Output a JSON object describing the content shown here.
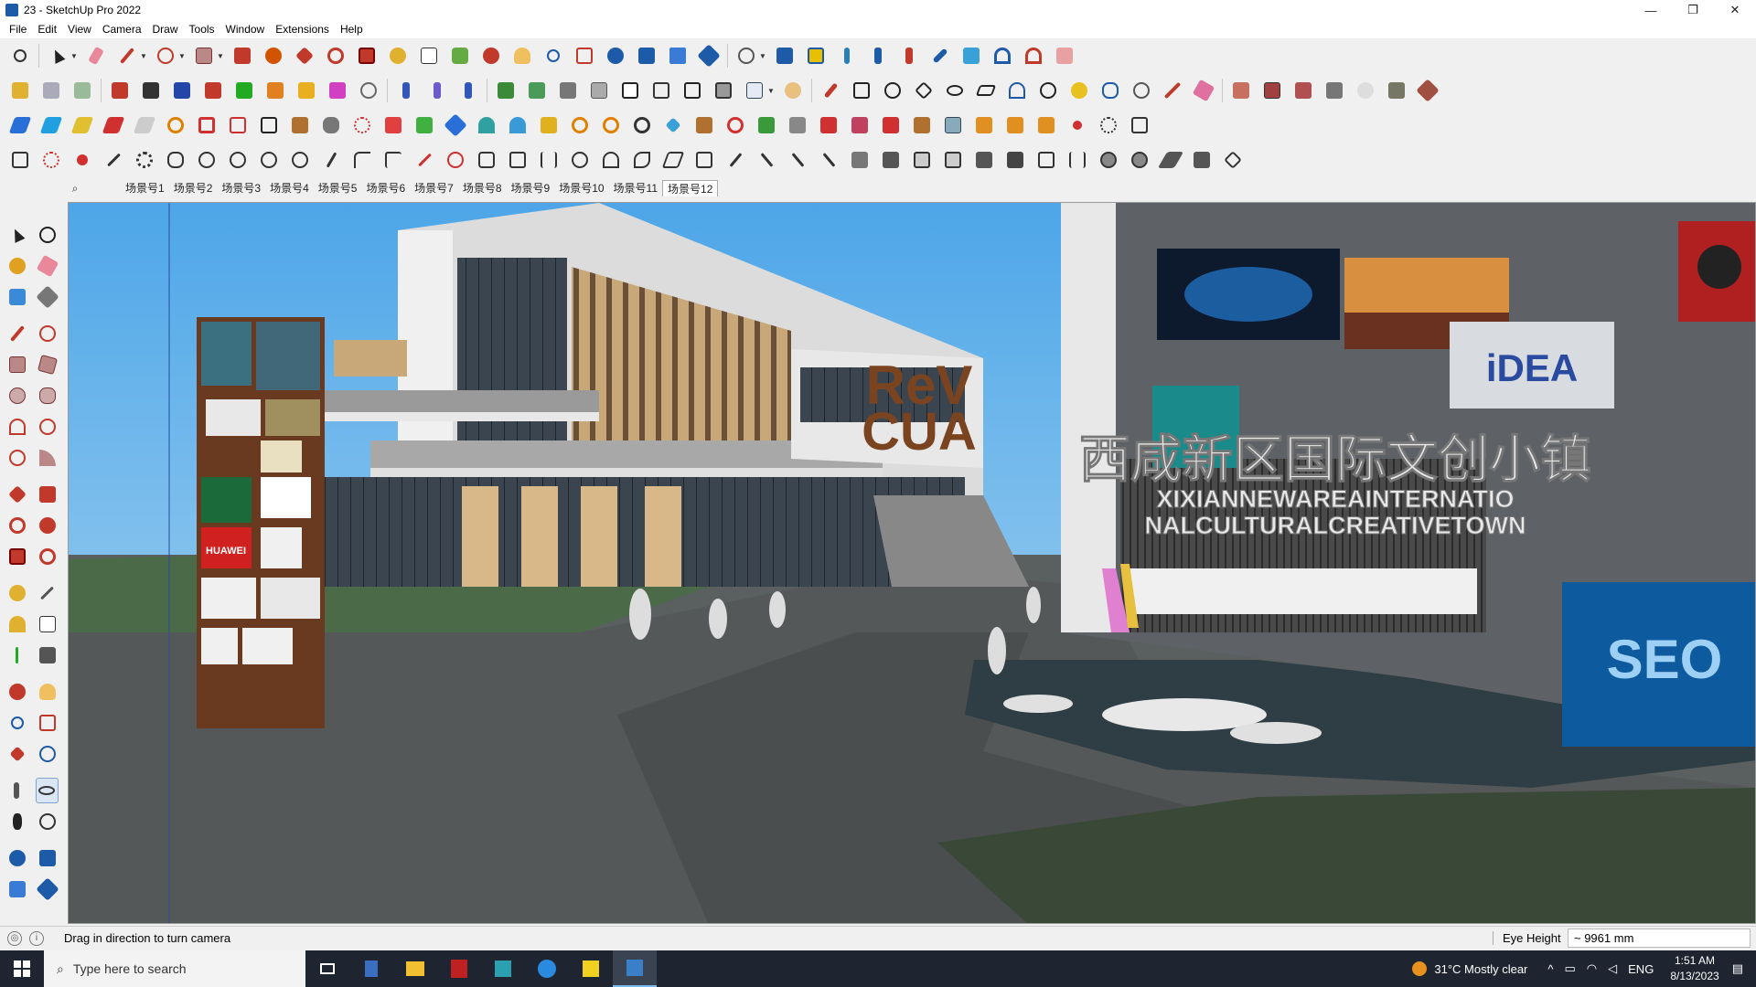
{
  "window": {
    "title": "23 - SketchUp Pro 2022",
    "controls": [
      "—",
      "❐",
      "✕"
    ]
  },
  "menu": [
    "File",
    "Edit",
    "View",
    "Camera",
    "Draw",
    "Tools",
    "Window",
    "Extensions",
    "Help"
  ],
  "scenes": {
    "tabs": [
      "场景号1",
      "场景号2",
      "场景号3",
      "场景号4",
      "场景号5",
      "场景号6",
      "场景号7",
      "场景号8",
      "场景号9",
      "场景号10",
      "场景号11",
      "场景号12"
    ],
    "active_index": 11
  },
  "viewport": {
    "sign_cn": "西咸新区国际文创小镇",
    "sign_en_1": "XIXIANNEWAREAINTERNATIO",
    "sign_en_2": "NALCULTURALCREATIVETOWN",
    "billboard_idea": "iDEA",
    "billboard_seo": "SEO",
    "letters_rev": "ReV",
    "letters_cua": "CUA",
    "kiosk_huawei": "HUAWEI"
  },
  "status": {
    "message": "Drag in direction to turn camera",
    "eye_height_label": "Eye Height",
    "eye_height_value": "~ 9961 mm"
  },
  "taskbar": {
    "search_placeholder": "Type here to search",
    "weather": "31°C  Mostly clear",
    "lang": "ENG",
    "time": "1:51 AM",
    "date": "8/13/2023"
  }
}
